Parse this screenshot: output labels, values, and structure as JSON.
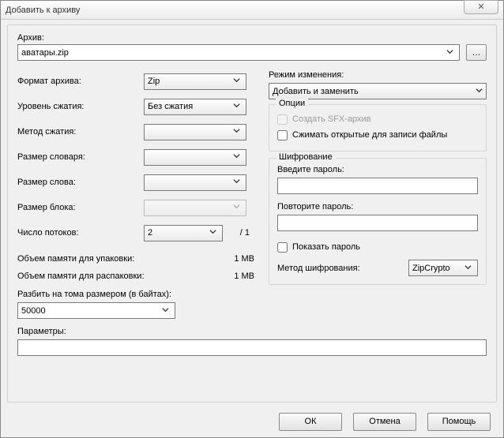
{
  "window": {
    "title": "Добавить к архиву"
  },
  "archive": {
    "label": "Архив:",
    "value": "аватары.zip"
  },
  "left": {
    "format": {
      "label": "Формат архива:",
      "value": "Zip"
    },
    "level": {
      "label": "Уровень сжатия:",
      "value": "Без сжатия"
    },
    "method": {
      "label": "Метод сжатия:",
      "value": ""
    },
    "dict": {
      "label": "Размер словаря:",
      "value": ""
    },
    "word": {
      "label": "Размер слова:",
      "value": ""
    },
    "block": {
      "label": "Размер блока:",
      "value": ""
    },
    "threads": {
      "label": "Число потоков:",
      "value": "2",
      "suffix": "/ 1"
    },
    "mem_pack": {
      "label": "Объем памяти для упаковки:",
      "value": "1 MB"
    },
    "mem_unpack": {
      "label": "Объем памяти для распаковки:",
      "value": "1 MB"
    },
    "split": {
      "label": "Разбить на тома размером (в байтах):",
      "value": "50000"
    }
  },
  "right": {
    "mode": {
      "label": "Режим изменения:",
      "value": "Добавить и заменить"
    },
    "options": {
      "legend": "Опции",
      "sfx": "Создать SFX-архив",
      "open_shared": "Сжимать открытые для записи файлы"
    },
    "encryption": {
      "legend": "Шифрование",
      "pass1": "Введите пароль:",
      "pass2": "Повторите пароль:",
      "show": "Показать пароль",
      "method_label": "Метод шифрования:",
      "method_value": "ZipCrypto"
    }
  },
  "params": {
    "label": "Параметры:",
    "value": ""
  },
  "footer": {
    "ok": "ОК",
    "cancel": "Отмена",
    "help": "Помощь"
  }
}
